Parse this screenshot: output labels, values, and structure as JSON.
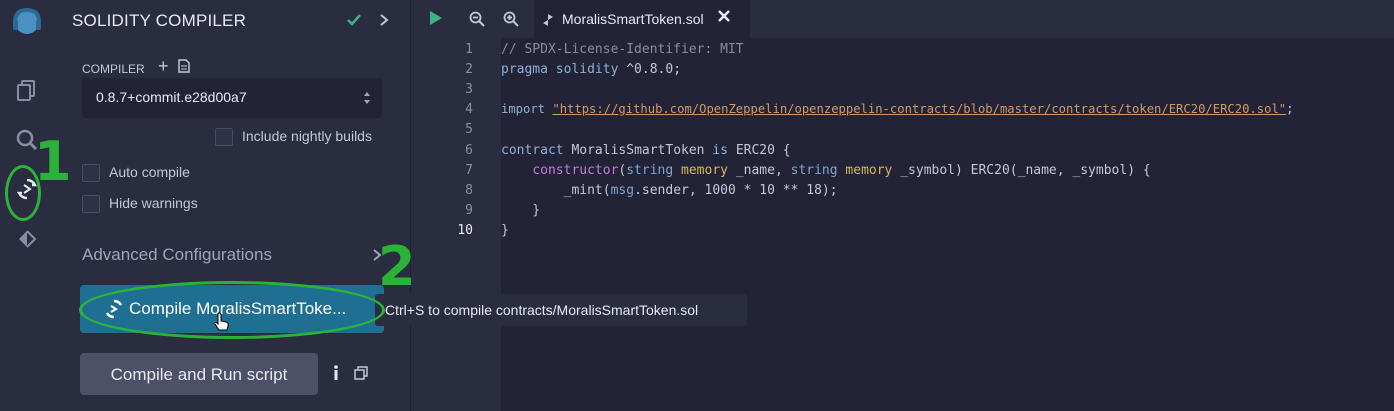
{
  "panel": {
    "title": "SOLIDITY COMPILER",
    "compiler_label": "COMPILER",
    "compiler_version": "0.8.7+commit.e28d00a7",
    "include_nightly": "Include nightly builds",
    "auto_compile": "Auto compile",
    "hide_warnings": "Hide warnings",
    "advanced": "Advanced Configurations",
    "compile_button": "Compile MoralisSmartToke...",
    "compile_run_button": "Compile and Run script"
  },
  "tooltip": "Ctrl+S to compile contracts/MoralisSmartToken.sol",
  "editor": {
    "tab_name": "MoralisSmartToken.sol",
    "line_numbers": [
      "1",
      "2",
      "3",
      "4",
      "5",
      "6",
      "7",
      "8",
      "9",
      "10"
    ],
    "lines": {
      "l1": "// SPDX-License-Identifier: MIT",
      "l2_kw": "pragma solidity",
      "l2_rest": " ^0.8.0;",
      "l4_kw": "import",
      "l4_str": "\"https://github.com/OpenZeppelin/openzeppelin-contracts/blob/master/contracts/token/ERC20/ERC20.sol\"",
      "l4_end": ";",
      "l6_kw": "contract",
      "l6_name": " MoralisSmartToken ",
      "l6_is": "is",
      "l6_rest": " ERC20 {",
      "l7_indent": "    ",
      "l7_kw": "constructor",
      "l7_a": "(",
      "l7_t1": "string",
      "l7_sp1": " ",
      "l7_m1": "memory",
      "l7_b": " _name, ",
      "l7_t2": "string",
      "l7_sp2": " ",
      "l7_m2": "memory",
      "l7_c": " _symbol) ERC20(_name, _symbol) {",
      "l8_indent": "        _mint(",
      "l8_msg": "msg",
      "l8_rest": ".sender, 1000 * 10 ** 18);",
      "l9": "    }",
      "l10": "}"
    }
  },
  "annotations": {
    "one": "1",
    "two": "2"
  },
  "colors": {
    "accent": "#1f6f92",
    "annotation": "#2bb339",
    "check": "#3fb37f"
  }
}
